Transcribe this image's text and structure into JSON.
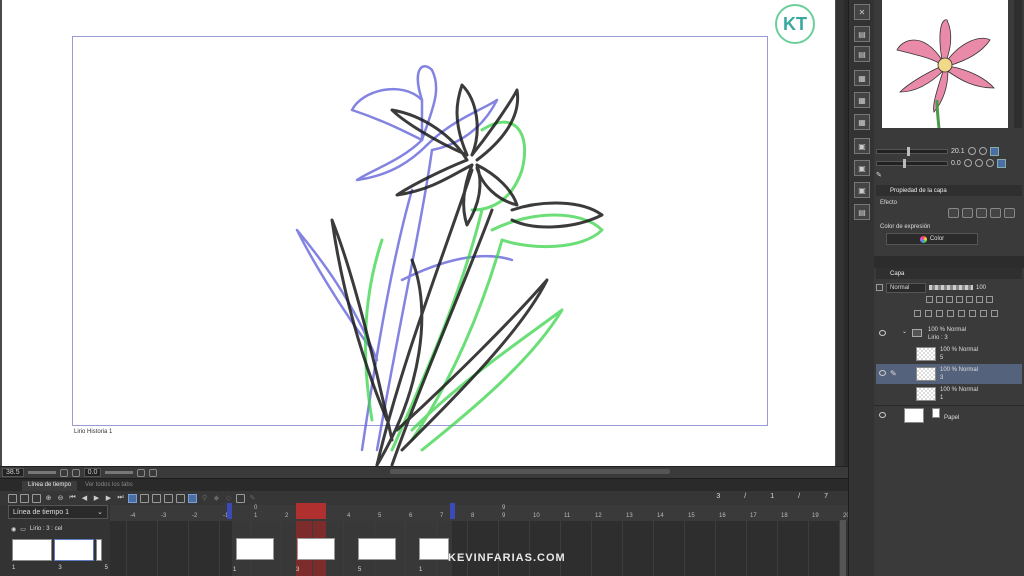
{
  "canvas": {
    "frame_label": "Lirio Historia 1",
    "logo_text": "KT"
  },
  "status_bar": {
    "zoom": "38.5",
    "angle": "0.0"
  },
  "timeline": {
    "tabs": [
      {
        "label": "Línea de tiempo"
      },
      {
        "label": "Ver todos los tabs"
      }
    ],
    "select_label": "Línea de tiempo 1",
    "track_name": "Lirio : 3 : cel",
    "counter": {
      "frame": "3",
      "sep1": "/",
      "count": "1",
      "sep2": "/",
      "total": "7"
    },
    "ruler_top": [
      "0",
      "3",
      "9"
    ],
    "ruler_bottom": [
      "-4",
      "-3",
      "-2",
      "-1",
      "1",
      "2",
      "3",
      "4",
      "5",
      "6",
      "7",
      "8",
      "9",
      "10",
      "11",
      "12",
      "13",
      "14",
      "15",
      "16",
      "17",
      "18",
      "19",
      "20"
    ],
    "left_nums": [
      "1",
      "3",
      "5"
    ],
    "cel_nums": [
      "1",
      "3",
      "5",
      "1"
    ],
    "watermark": "KEVINFARIAS.COM"
  },
  "navigator": {
    "zoom_value": "20.1",
    "rotate_value": "0.0"
  },
  "layer_property": {
    "title": "Propiedad de la capa",
    "effect_label": "Efecto",
    "color_label": "Color de expresión",
    "color_value": "Color"
  },
  "layers": {
    "title": "Capa",
    "blend_mode": "Normal",
    "opacity": "100",
    "rows": [
      {
        "line1": "100 % Normal",
        "line2": "Lirio : 3"
      },
      {
        "line1": "100 % Normal",
        "line2": "5"
      },
      {
        "line1": "100 % Normal",
        "line2": "3"
      },
      {
        "line1": "100 % Normal",
        "line2": "1"
      },
      {
        "line1": "",
        "line2": "Papel"
      }
    ]
  },
  "colors": {
    "accent": "#4a6fa5",
    "playhead": "#b03030",
    "range_marker": "#3a4ab8",
    "selected_layer": "#55627c"
  }
}
